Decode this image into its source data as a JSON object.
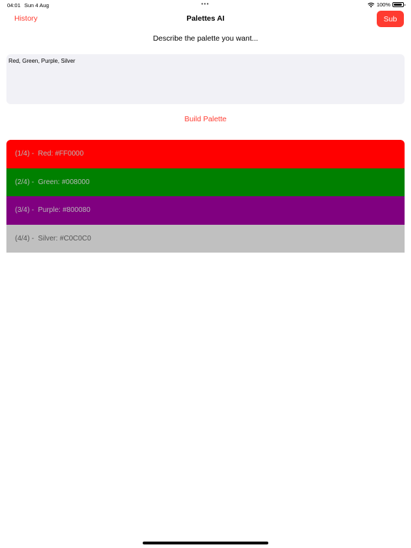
{
  "status_bar": {
    "time": "04:01",
    "date": "Sun 4 Aug",
    "dots": "•••",
    "battery": "100%"
  },
  "nav": {
    "history_label": "History",
    "title": "Palettes AI",
    "sub_label": "Sub"
  },
  "prompt": {
    "label": "Describe the palette you want...",
    "value": "Red, Green, Purple, Silver"
  },
  "build_label": "Build Palette",
  "palette": {
    "items": [
      {
        "index": "(1/4) -  ",
        "text": "Red: #FF0000",
        "color": "#FF0000"
      },
      {
        "index": "(2/4) -  ",
        "text": "Green: #008000",
        "color": "#008000"
      },
      {
        "index": "(3/4) -  ",
        "text": "Purple: #800080",
        "color": "#800080"
      },
      {
        "index": "(4/4) -  ",
        "text": "Silver: #C0C0C0",
        "color": "#C0C0C0"
      }
    ]
  },
  "colors": {
    "accent": "#ff3b30",
    "input_bg": "#f1f1f6"
  }
}
